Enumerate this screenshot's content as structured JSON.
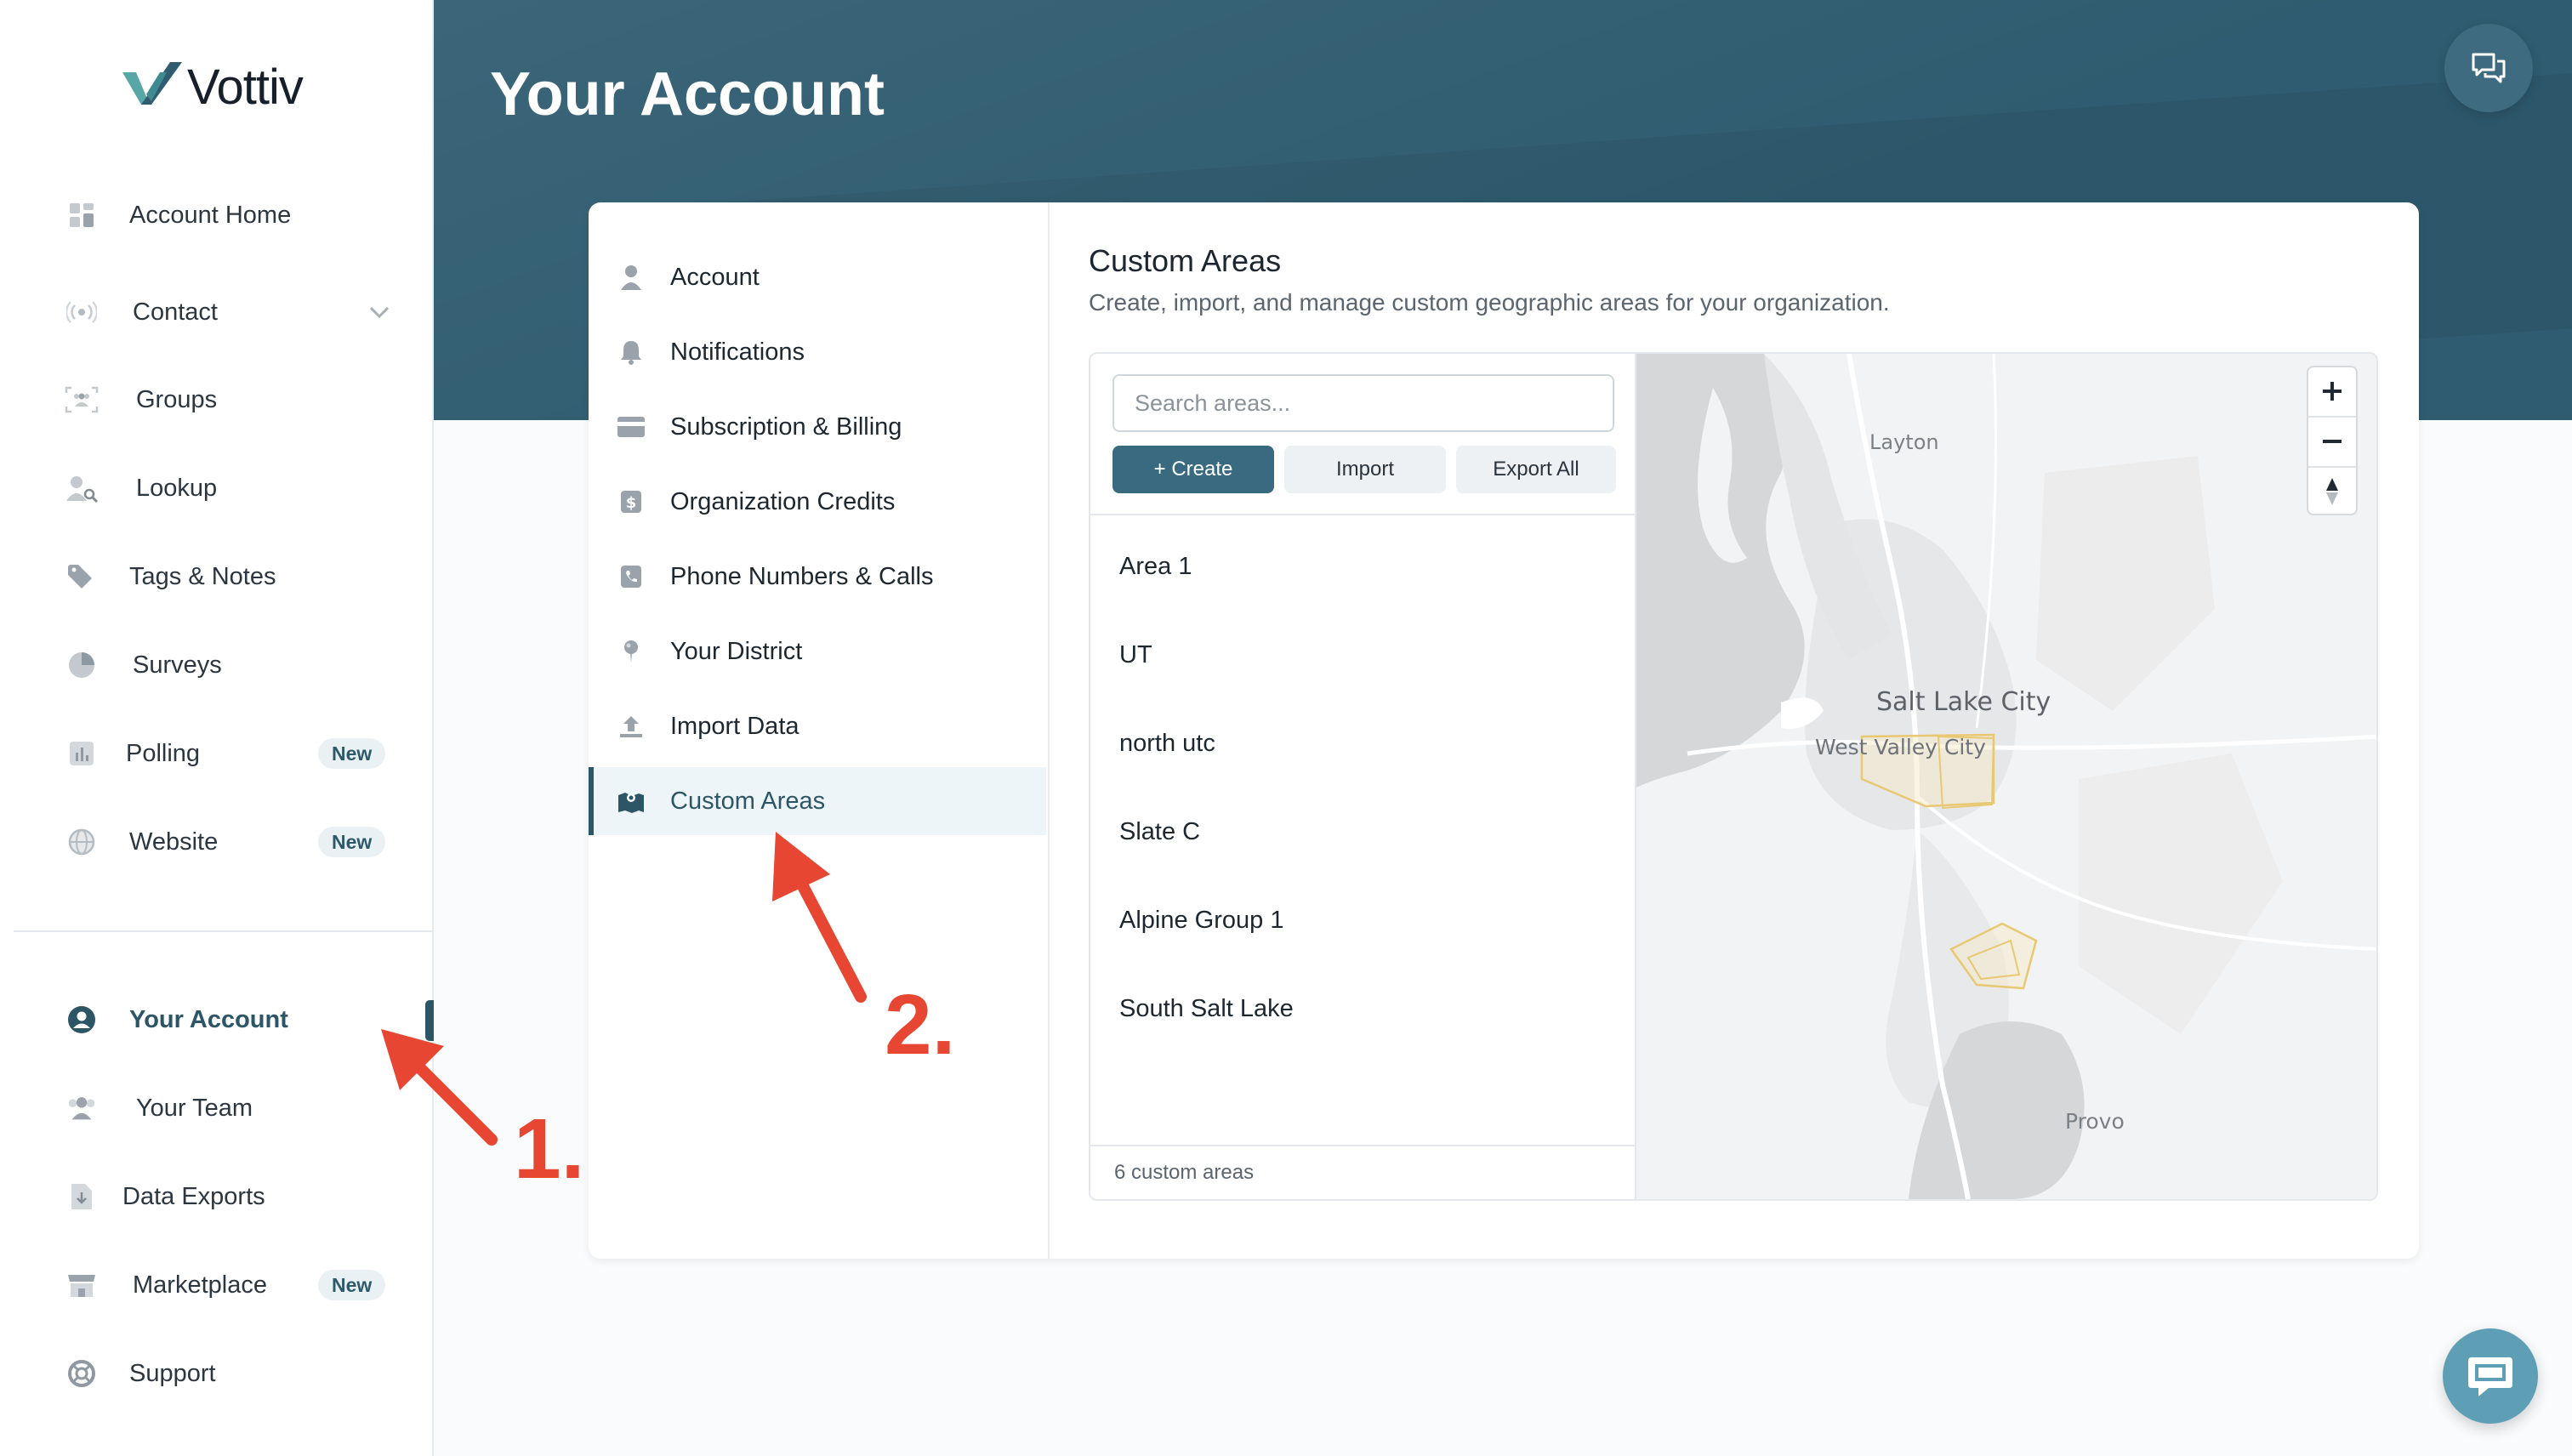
{
  "brand": {
    "name": "Vottiv",
    "color_primary": "#2f5c70",
    "color_accent": "#58a6a6"
  },
  "sidebar": {
    "items": [
      {
        "label": "Account Home",
        "icon": "dashboard-icon"
      },
      {
        "label": "Contact",
        "icon": "broadcast-icon"
      },
      {
        "label": "Groups",
        "icon": "groups-icon"
      },
      {
        "label": "Lookup",
        "icon": "user-search-icon"
      },
      {
        "label": "Tags & Notes",
        "icon": "tag-icon"
      },
      {
        "label": "Surveys",
        "icon": "pie-chart-icon"
      },
      {
        "label": "Polling",
        "icon": "bar-chart-icon",
        "badge": "New"
      },
      {
        "label": "Website",
        "icon": "globe-icon",
        "badge": "New"
      }
    ],
    "bottom_items": [
      {
        "label": "Your Account",
        "icon": "user-circle-icon",
        "active": true
      },
      {
        "label": "Your Team",
        "icon": "team-icon"
      },
      {
        "label": "Data Exports",
        "icon": "file-download-icon"
      },
      {
        "label": "Marketplace",
        "icon": "store-icon",
        "badge": "New"
      },
      {
        "label": "Support",
        "icon": "lifebuoy-icon"
      }
    ]
  },
  "header": {
    "title": "Your Account"
  },
  "settings_nav": {
    "items": [
      {
        "label": "Account",
        "icon": "person-icon"
      },
      {
        "label": "Notifications",
        "icon": "bell-icon"
      },
      {
        "label": "Subscription & Billing",
        "icon": "credit-card-icon"
      },
      {
        "label": "Organization Credits",
        "icon": "dollar-icon"
      },
      {
        "label": "Phone Numbers & Calls",
        "icon": "phone-icon"
      },
      {
        "label": "Your District",
        "icon": "pin-icon"
      },
      {
        "label": "Import Data",
        "icon": "upload-icon"
      },
      {
        "label": "Custom Areas",
        "icon": "map-icon",
        "active": true
      }
    ]
  },
  "custom_areas": {
    "title": "Custom Areas",
    "subtitle": "Create, import, and manage custom geographic areas for your organization.",
    "search_placeholder": "Search areas...",
    "buttons": {
      "create": "+ Create",
      "import": "Import",
      "export": "Export All"
    },
    "areas": [
      "Area 1",
      "UT",
      "north utc",
      "Slate C",
      "Alpine Group 1",
      "South Salt Lake"
    ],
    "count_text": "6 custom areas"
  },
  "map": {
    "labels": {
      "layton": "Layton",
      "slc": "Salt Lake City",
      "wvc": "West Valley City",
      "provo": "Provo"
    }
  },
  "annotations": {
    "step1": "1.",
    "step2": "2.",
    "color": "#e64632"
  }
}
